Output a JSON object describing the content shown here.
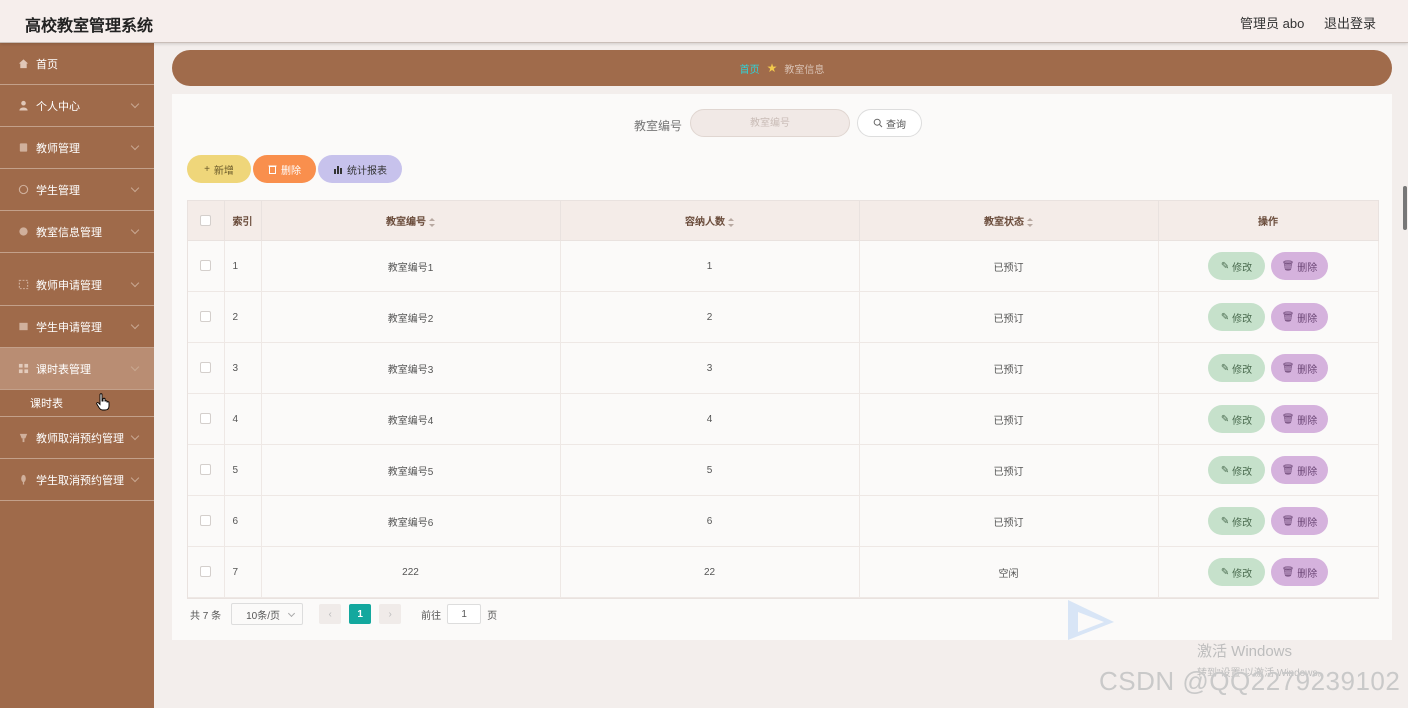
{
  "app": {
    "title": "高校教室管理系统"
  },
  "header": {
    "user": "管理员 abo",
    "logout": "退出登录"
  },
  "sidebar": {
    "items": [
      {
        "label": "首页",
        "icon": "home-icon"
      },
      {
        "label": "个人中心",
        "icon": "user-icon"
      },
      {
        "label": "教师管理",
        "icon": "teacher-icon"
      },
      {
        "label": "学生管理",
        "icon": "student-icon"
      },
      {
        "label": "教室信息管理",
        "icon": "classroom-icon"
      },
      {
        "label": "教师申请管理",
        "icon": "apply-icon"
      },
      {
        "label": "学生申请管理",
        "icon": "apply-icon"
      },
      {
        "label": "课时表管理",
        "icon": "grid-icon"
      },
      {
        "label": "教师取消预约管理",
        "icon": "cancel-icon"
      },
      {
        "label": "学生取消预约管理",
        "icon": "cancel-icon"
      }
    ],
    "sub_item": "课时表"
  },
  "breadcrumb": {
    "home": "首页",
    "current": "教室信息"
  },
  "search": {
    "label": "教室编号",
    "placeholder": "教室编号",
    "button": "查询"
  },
  "toolbar": {
    "add": "新增",
    "delete": "删除",
    "stats": "统计报表"
  },
  "table": {
    "columns": [
      "索引",
      "教室编号",
      "容纳人数",
      "教室状态",
      "操作"
    ],
    "rows": [
      {
        "index": "1",
        "code": "教室编号1",
        "capacity": "1",
        "status": "已预订"
      },
      {
        "index": "2",
        "code": "教室编号2",
        "capacity": "2",
        "status": "已预订"
      },
      {
        "index": "3",
        "code": "教室编号3",
        "capacity": "3",
        "status": "已预订"
      },
      {
        "index": "4",
        "code": "教室编号4",
        "capacity": "4",
        "status": "已预订"
      },
      {
        "index": "5",
        "code": "教室编号5",
        "capacity": "5",
        "status": "已预订"
      },
      {
        "index": "6",
        "code": "教室编号6",
        "capacity": "6",
        "status": "已预订"
      },
      {
        "index": "7",
        "code": "222",
        "capacity": "22",
        "status": "空闲"
      }
    ],
    "edit_label": "修改",
    "delete_label": "删除"
  },
  "pagination": {
    "total": "共 7 条",
    "page_size": "10条/页",
    "current_page": "1",
    "goto_prefix": "前往",
    "goto_value": "1",
    "goto_suffix": "页"
  },
  "overlay": {
    "windows_activate": "激活 Windows",
    "windows_activate_hint": "转到\"设置\"以激活 Windows。",
    "watermark": "CSDN @QQ2279239102"
  },
  "colors": {
    "sidebar": "#9f6a4a",
    "breadcrumb_bar": "#a06b4b",
    "add_button": "#efd67a",
    "delete_button": "#f98f4d",
    "stats_button": "#c7c2ec",
    "edit_pill": "#c6e1cb",
    "delete_pill": "#d5b2dd",
    "page_active": "#13a89e"
  }
}
